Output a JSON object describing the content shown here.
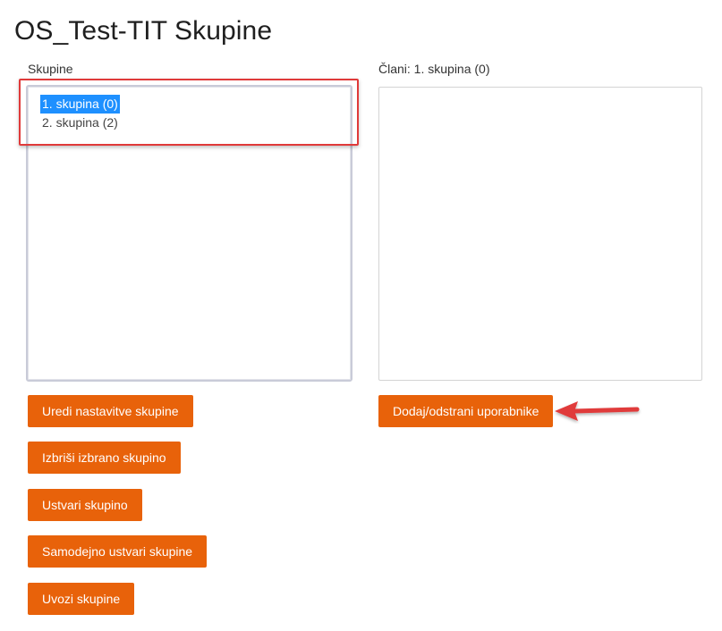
{
  "page": {
    "title": "OS_Test-TIT Skupine"
  },
  "groups": {
    "label": "Skupine",
    "items": [
      {
        "label": "1. skupina (0)",
        "selected": true
      },
      {
        "label": "2. skupina (2)",
        "selected": false
      }
    ]
  },
  "members": {
    "label": "Člani: 1. skupina (0)"
  },
  "buttons": {
    "edit_settings": "Uredi nastavitve skupine",
    "delete_selected": "Izbriši izbrano skupino",
    "create": "Ustvari skupino",
    "auto_create": "Samodejno ustvari skupine",
    "import": "Uvozi skupine",
    "add_remove_users": "Dodaj/odstrani uporabnike"
  },
  "colors": {
    "button": "#e8620a",
    "selection": "#1e90ff",
    "annotation": "#e03a3a"
  }
}
